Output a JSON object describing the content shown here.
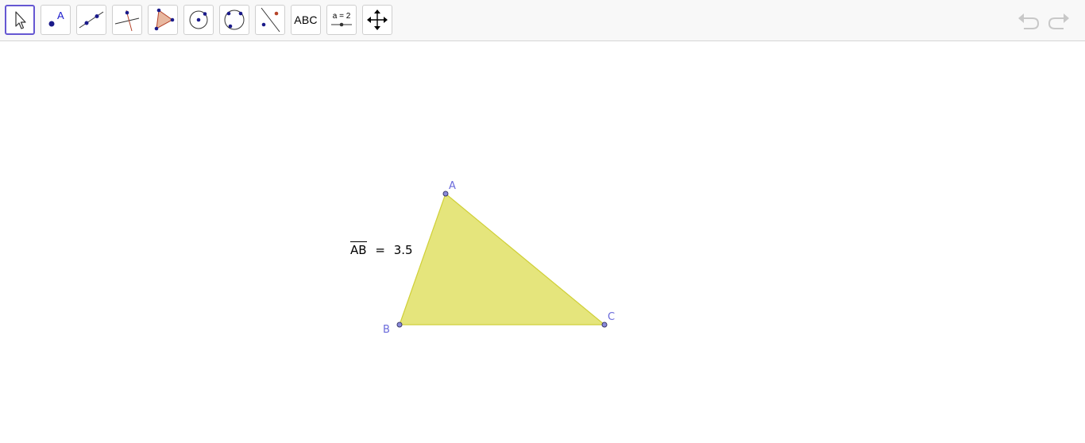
{
  "toolbar": {
    "tools": [
      {
        "id": "move",
        "icon": "cursor-arrow-icon",
        "selected": true
      },
      {
        "id": "point",
        "icon": "point-icon",
        "label": "A"
      },
      {
        "id": "line",
        "icon": "line-through-points-icon"
      },
      {
        "id": "perpendicular",
        "icon": "perpendicular-line-icon"
      },
      {
        "id": "polygon",
        "icon": "polygon-icon"
      },
      {
        "id": "circle",
        "icon": "circle-center-point-icon"
      },
      {
        "id": "conic",
        "icon": "circle-three-points-icon"
      },
      {
        "id": "reflect",
        "icon": "reflect-about-line-icon"
      },
      {
        "id": "text",
        "icon": "text-icon",
        "label": "ABC"
      },
      {
        "id": "slider",
        "icon": "slider-icon",
        "label": "a = 2"
      },
      {
        "id": "move-view",
        "icon": "move-graphics-view-icon"
      }
    ],
    "undo_icon": "undo-icon",
    "redo_icon": "redo-icon"
  },
  "construction": {
    "points": {
      "A": {
        "label": "A"
      },
      "B": {
        "label": "B"
      },
      "C": {
        "label": "C"
      }
    },
    "measurement": {
      "segment": "AB",
      "equals": "=",
      "value": "3.5"
    },
    "colors": {
      "polygon_fill": "#e5e57c",
      "polygon_stroke": "#d9d94a",
      "point_fill": "#8a8adb",
      "point_stroke": "#3a3a6a",
      "label_color": "#6a6adb",
      "tool_selected_border": "#6557d2"
    }
  }
}
